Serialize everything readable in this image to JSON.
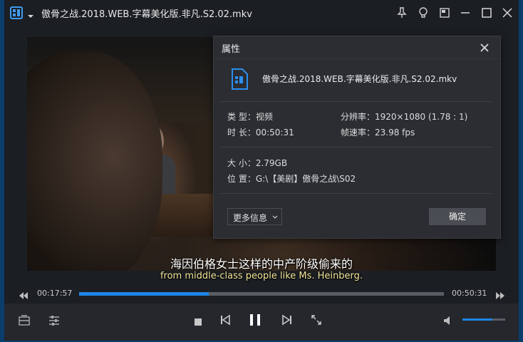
{
  "window": {
    "title": "傲骨之战.2018.WEB.字幕美化版.非凡.S2.02.mkv"
  },
  "subtitle": {
    "zh": "海因伯格女士这样的中产阶级偷来的",
    "en": "from middle-class people like Ms. Heinberg."
  },
  "playback": {
    "elapsed": "00:17:57",
    "total": "00:50:31",
    "progress_fraction": 0.355,
    "volume_fraction": 0.7
  },
  "properties_dialog": {
    "title": "属性",
    "file_name": "傲骨之战.2018.WEB.字幕美化版.非凡.S2.02.mkv",
    "type": "类 型：视频",
    "resolution": "分辨率：1920×1080 (1.78 : 1)",
    "duration": "时 长：00:50:31",
    "frame_rate": "帧速率：23.98 fps",
    "size": "大 小：2.79GB",
    "location": "位 置：G:\\【美剧】傲骨之战\\S02",
    "more_info_label": "更多信息",
    "ok_label": "确定"
  },
  "colors": {
    "accent": "#1f86e6",
    "window_bg": "#1b1e23",
    "dialog_bg": "#2b2d32",
    "subtitle_en": "#f3e79a"
  },
  "icons": {
    "app_logo": "player-logo-icon",
    "menu": "chevron-down-icon",
    "pin": "pin-icon",
    "bulb": "bulb-icon",
    "mini": "mini-mode-icon",
    "minimize": "minimize-icon",
    "maximize": "maximize-icon",
    "close": "close-icon",
    "rewind": "rewind-icon",
    "forward": "fast-forward-icon",
    "playlist": "playlist-icon",
    "settings": "equalizer-icon",
    "stop": "stop-icon",
    "prev": "previous-icon",
    "pause": "pause-icon",
    "next": "next-icon",
    "fullscreen": "fullscreen-icon",
    "volume": "volume-icon",
    "video_file": "video-file-icon"
  }
}
